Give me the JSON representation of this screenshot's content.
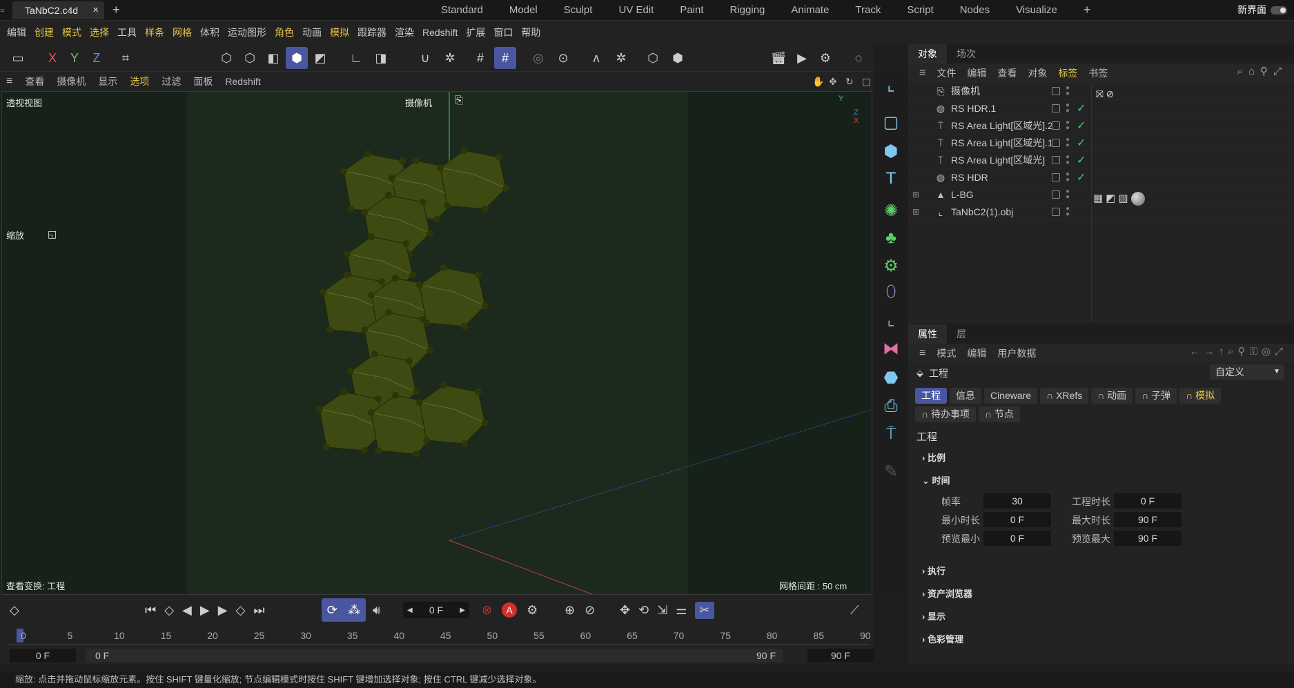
{
  "tab": {
    "file": "TaNbC2.c4d",
    "close": "×",
    "add": "+"
  },
  "layouts": [
    "Standard",
    "Model",
    "Sculpt",
    "UV Edit",
    "Paint",
    "Rigging",
    "Animate",
    "Track",
    "Script",
    "Nodes",
    "Visualize"
  ],
  "layout_add": "+",
  "new_ui": "新界面",
  "menu": [
    {
      "label": "编辑",
      "hl": false
    },
    {
      "label": "创建",
      "hl": true
    },
    {
      "label": "模式",
      "hl": true
    },
    {
      "label": "选择",
      "hl": true
    },
    {
      "label": "工具",
      "hl": false
    },
    {
      "label": "样条",
      "hl": true
    },
    {
      "label": "网格",
      "hl": true
    },
    {
      "label": "体积",
      "hl": false
    },
    {
      "label": "运动图形",
      "hl": false
    },
    {
      "label": "角色",
      "hl": true
    },
    {
      "label": "动画",
      "hl": false
    },
    {
      "label": "模拟",
      "hl": true
    },
    {
      "label": "跟踪器",
      "hl": false
    },
    {
      "label": "渲染",
      "hl": false
    },
    {
      "label": "Redshift",
      "hl": false
    },
    {
      "label": "扩展",
      "hl": false
    },
    {
      "label": "窗口",
      "hl": false
    },
    {
      "label": "帮助",
      "hl": false
    }
  ],
  "toolbar": {
    "x": "X",
    "y": "Y",
    "z": "Z"
  },
  "vp_menu": [
    "查看",
    "摄像机",
    "显示",
    "选项",
    "过滤",
    "面板",
    "Redshift"
  ],
  "viewport": {
    "title": "透视视图",
    "camera": "摄像机",
    "zoom": "缩放",
    "transform": "查看变换: 工程",
    "grid": "网格间距 : 50 cm",
    "axis_y": "Y",
    "axis_z": "Z",
    "axis_x": "X"
  },
  "objects": {
    "tabs": [
      "对象",
      "场次"
    ],
    "menu": [
      {
        "label": "文件",
        "hl": false
      },
      {
        "label": "编辑",
        "hl": false
      },
      {
        "label": "查看",
        "hl": false
      },
      {
        "label": "对象",
        "hl": false
      },
      {
        "label": "标签",
        "hl": true
      },
      {
        "label": "书签",
        "hl": false
      }
    ],
    "rows": [
      {
        "name": "摄像机",
        "icon": "camera-icon",
        "glyph": "⎘",
        "check": false,
        "expand": ""
      },
      {
        "name": "RS HDR.1",
        "icon": "globe-icon",
        "glyph": "◍",
        "check": true,
        "expand": ""
      },
      {
        "name": "RS Area Light[区域光].2",
        "icon": "light-icon",
        "glyph": "⍑",
        "check": true,
        "expand": ""
      },
      {
        "name": "RS Area Light[区域光].1",
        "icon": "light-icon",
        "glyph": "⍑",
        "check": true,
        "expand": ""
      },
      {
        "name": "RS Area Light[区域光]",
        "icon": "light-icon",
        "glyph": "⍑",
        "check": true,
        "expand": ""
      },
      {
        "name": "RS HDR",
        "icon": "globe-icon",
        "glyph": "◍",
        "check": true,
        "expand": ""
      },
      {
        "name": "L-BG",
        "icon": "background-icon",
        "glyph": "▲",
        "check": false,
        "expand": "⊞"
      },
      {
        "name": "TaNbC2(1).obj",
        "icon": "null-object-icon",
        "glyph": "⌞",
        "check": false,
        "expand": "⊞"
      }
    ]
  },
  "attributes": {
    "tabs": [
      "属性",
      "层"
    ],
    "menu": [
      "模式",
      "编辑",
      "用户数据"
    ],
    "section": "工程",
    "preset": "自定义",
    "buttons": [
      {
        "label": "工程",
        "state": "on"
      },
      {
        "label": "信息",
        "state": ""
      },
      {
        "label": "Cineware",
        "state": ""
      },
      {
        "label": "XRefs",
        "state": ""
      },
      {
        "label": "动画",
        "state": ""
      },
      {
        "label": "子弹",
        "state": ""
      },
      {
        "label": "模拟",
        "state": "yl"
      },
      {
        "label": "待办事项",
        "state": ""
      },
      {
        "label": "节点",
        "state": ""
      }
    ],
    "heading": "工程",
    "groups": {
      "scale": "比例",
      "time": "时间",
      "exec": "执行",
      "asset": "资产浏览器",
      "display": "显示",
      "color": "色彩管理"
    },
    "time": {
      "fps_label": "帧率",
      "fps": "30",
      "duration_label": "工程时长",
      "duration": "0 F",
      "min_label": "最小时长",
      "min": "0 F",
      "max_label": "最大时长",
      "max": "90 F",
      "pmin_label": "预览最小",
      "pmin": "0 F",
      "pmax_label": "预览最大",
      "pmax": "90 F"
    }
  },
  "timeline": {
    "frame": "0 F",
    "ticks": [
      "0",
      "5",
      "10",
      "15",
      "20",
      "25",
      "30",
      "35",
      "40",
      "45",
      "50",
      "55",
      "60",
      "65",
      "70",
      "75",
      "80",
      "85",
      "90"
    ],
    "start": "0 F",
    "range_start": "0 F",
    "range_end": "90 F",
    "end": "90 F"
  },
  "status": "缩放: 点击并拖动鼠标缩放元素。按住 SHIFT 键量化缩放; 节点编辑模式时按住 SHIFT 键增加选择对象; 按住 CTRL 键减少选择对象。",
  "colors": {
    "accent": "#4a56a0",
    "highlight": "#e8c84a",
    "check": "#4ad06a",
    "viewport": "#1b2a1d",
    "crystal": "#3d4a12"
  }
}
